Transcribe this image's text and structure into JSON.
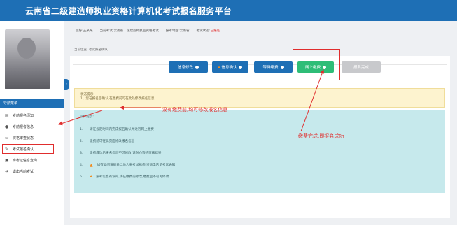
{
  "header": {
    "title": "云南省二级建造师执业资格计算机化考试报名服务平台"
  },
  "infobar": {
    "items": [
      {
        "label": "您好:",
        "value": "王某某"
      },
      {
        "label": "当前考试:",
        "value": "云南省二级建造师执业资格考试"
      },
      {
        "label": "报考地区:",
        "value": "云南省"
      },
      {
        "label": "考试状态:",
        "value": "已报名",
        "highlight": true
      }
    ]
  },
  "sidebar": {
    "menu_header": "导航菜单",
    "collapse_glyph": "‹",
    "items": [
      {
        "label": "考前报名须知",
        "icon": "document-icon",
        "glyph": "▤"
      },
      {
        "label": "考前报考信息",
        "icon": "info-icon",
        "glyph": "●"
      },
      {
        "label": "资格审查状态",
        "icon": "monitor-icon",
        "glyph": "▭"
      },
      {
        "label": "考试报名确认",
        "icon": "edit-icon",
        "glyph": "✎",
        "highlighted": true
      },
      {
        "label": "准考证信息查询",
        "icon": "id-card-icon",
        "glyph": "▣"
      },
      {
        "label": "退出当前考试",
        "icon": "exit-icon",
        "glyph": "⇥"
      }
    ]
  },
  "breadcrumb": "当前位置: 考试报名确认",
  "steps": [
    {
      "label": "信息修改",
      "state": "done"
    },
    {
      "label": "信息确认",
      "state": "done"
    },
    {
      "label": "等待缴费",
      "state": "done"
    },
    {
      "label": "网上缴费",
      "state": "active"
    },
    {
      "label": "报名完成",
      "state": "disabled"
    }
  ],
  "notice": {
    "title": "状态提示:",
    "text": "1、您在报名后确认,在缴费前可在此处修改报名信息"
  },
  "operations": {
    "title": "操作提示:",
    "items": [
      "请在规定时间内完成报名确认并进行网上缴费",
      "缴费前可在此页面修改报名信息",
      "缴费成功后报名信息不可修改,请耐心等待审核结果",
      "如有疑问请联系当地人事考试机构,咨询电话见考试通知",
      "报考信息有误的,请在缴费前修改,缴费后不可再修改"
    ]
  },
  "annotations": {
    "unpaid": "没有缴费前,均可修改报名信息",
    "paid": "缴费完成,即报名成功"
  },
  "colors": {
    "primary": "#1e6fb5",
    "success": "#2ebd77",
    "disabled": "#c8c9cc",
    "annotation": "#e02d2d"
  }
}
